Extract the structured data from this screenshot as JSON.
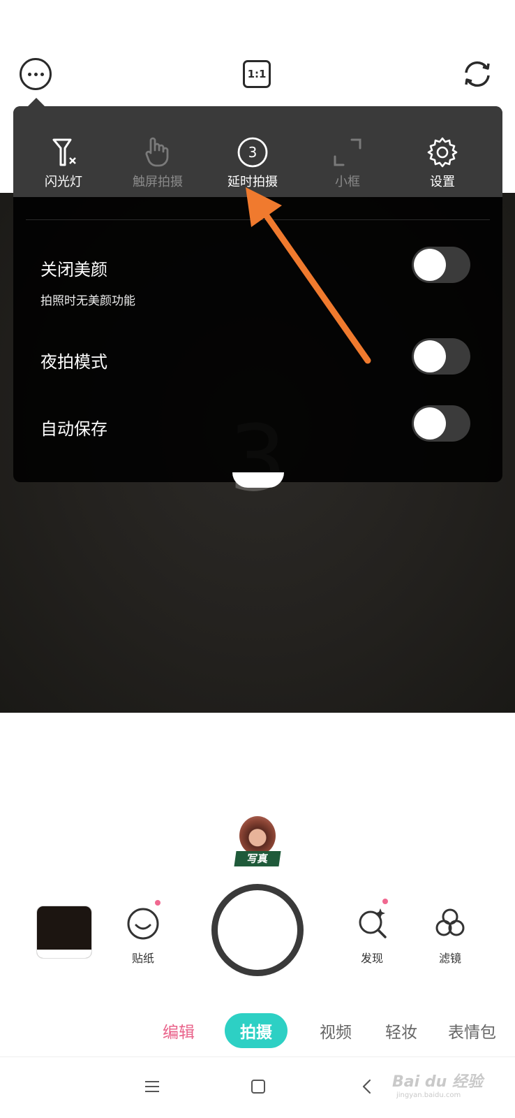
{
  "top_bar": {
    "ratio_label": "1:1",
    "more_icon": "more-dots-icon",
    "flip_icon": "camera-flip-icon"
  },
  "tools": [
    {
      "label": "闪光灯",
      "icon": "flash-off-icon",
      "enabled": true
    },
    {
      "label": "触屏拍摄",
      "icon": "touch-shoot-icon",
      "enabled": false
    },
    {
      "label": "延时拍摄",
      "icon": "timer-3-icon",
      "enabled": true,
      "badge": "3"
    },
    {
      "label": "小框",
      "icon": "small-frame-icon",
      "enabled": false
    },
    {
      "label": "设置",
      "icon": "gear-icon",
      "enabled": true
    }
  ],
  "settings": [
    {
      "title": "关闭美颜",
      "subtitle": "拍照时无美颜功能",
      "on": false
    },
    {
      "title": "夜拍模式",
      "on": false
    },
    {
      "title": "自动保存",
      "on": false
    }
  ],
  "preview": {
    "countdown": "3"
  },
  "sticker": {
    "tag": "写真"
  },
  "bottom_tools": [
    {
      "label": "贴纸",
      "icon": "sticker-smile-icon",
      "has_dot": true
    },
    {
      "label": "发现",
      "icon": "discover-search-icon",
      "has_dot": true
    },
    {
      "label": "滤镜",
      "icon": "filter-circles-icon",
      "has_dot": false
    }
  ],
  "modes": [
    {
      "label": "编辑",
      "state": "highlight"
    },
    {
      "label": "拍摄",
      "state": "active"
    },
    {
      "label": "视频",
      "state": "normal"
    },
    {
      "label": "轻妆",
      "state": "normal"
    },
    {
      "label": "表情包",
      "state": "normal"
    }
  ],
  "watermark": {
    "text": "Bai du 经验",
    "sub": "jingyan.baidu.com"
  },
  "colors": {
    "accent_teal": "#2dd0c4",
    "accent_pink": "#e9628a",
    "annotation_arrow": "#f07a2e"
  }
}
